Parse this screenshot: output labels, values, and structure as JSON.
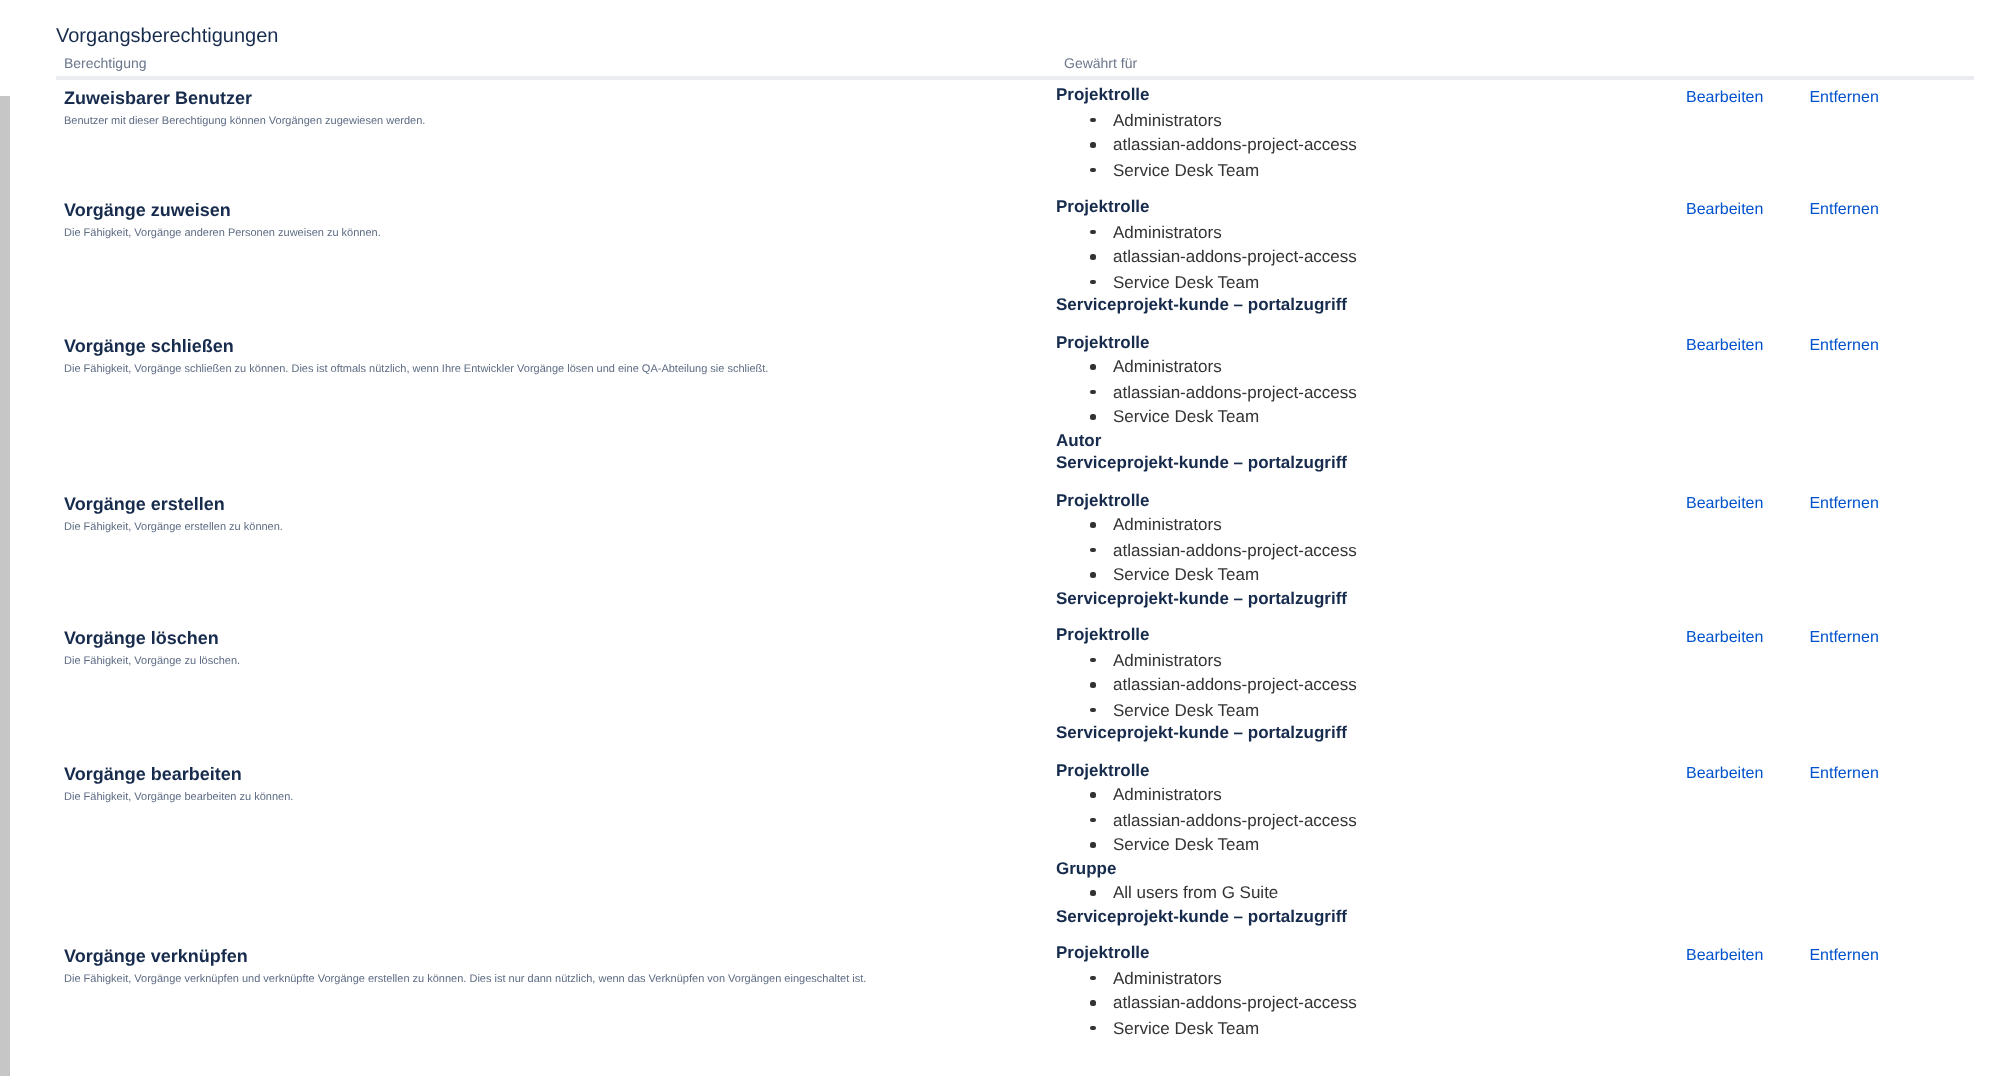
{
  "title": "Vorgangsberechtigungen",
  "columns": [
    "Berechtigung",
    "Gewährt für"
  ],
  "rows": [
    {
      "name": "Zuweisbarer Benutzer",
      "description": "Benutzer mit dieser Berechtigung können Vorgängen zugewiesen werden.",
      "grants": [
        {
          "label": "Projektrolle",
          "members": [
            "Administrators",
            "atlassian-addons-project-access",
            "Service Desk Team"
          ]
        }
      ],
      "actions": [
        "Bearbeiten",
        "Entfernen"
      ]
    },
    {
      "name": "Vorgänge zuweisen",
      "description": "Die Fähigkeit, Vorgänge anderen Personen zuweisen zu können.",
      "grants": [
        {
          "label": "Projektrolle",
          "members": [
            "Administrators",
            "atlassian-addons-project-access",
            "Service Desk Team"
          ]
        },
        {
          "label": "Serviceprojekt-kunde – portalzugriff"
        }
      ],
      "actions": [
        "Bearbeiten",
        "Entfernen"
      ]
    },
    {
      "name": "Vorgänge schließen",
      "description": "Die Fähigkeit, Vorgänge schließen zu können. Dies ist oftmals nützlich, wenn Ihre Entwickler Vorgänge lösen und eine QA-Abteilung sie schließt.",
      "grants": [
        {
          "label": "Projektrolle",
          "members": [
            "Administrators",
            "atlassian-addons-project-access",
            "Service Desk Team"
          ]
        },
        {
          "label": "Autor"
        },
        {
          "label": "Serviceprojekt-kunde – portalzugriff"
        }
      ],
      "actions": [
        "Bearbeiten",
        "Entfernen"
      ]
    },
    {
      "name": "Vorgänge erstellen",
      "description": "Die Fähigkeit, Vorgänge erstellen zu können.",
      "grants": [
        {
          "label": "Projektrolle",
          "members": [
            "Administrators",
            "atlassian-addons-project-access",
            "Service Desk Team"
          ]
        },
        {
          "label": "Serviceprojekt-kunde – portalzugriff"
        }
      ],
      "actions": [
        "Bearbeiten",
        "Entfernen"
      ]
    },
    {
      "name": "Vorgänge löschen",
      "description": "Die Fähigkeit, Vorgänge zu löschen.",
      "grants": [
        {
          "label": "Projektrolle",
          "members": [
            "Administrators",
            "atlassian-addons-project-access",
            "Service Desk Team"
          ]
        },
        {
          "label": "Serviceprojekt-kunde – portalzugriff"
        }
      ],
      "actions": [
        "Bearbeiten",
        "Entfernen"
      ]
    },
    {
      "name": "Vorgänge bearbeiten",
      "description": "Die Fähigkeit, Vorgänge bearbeiten zu können.",
      "grants": [
        {
          "label": "Projektrolle",
          "members": [
            "Administrators",
            "atlassian-addons-project-access",
            "Service Desk Team"
          ]
        },
        {
          "label": "Gruppe",
          "members": [
            "All users from G Suite"
          ]
        },
        {
          "label": "Serviceprojekt-kunde – portalzugriff"
        }
      ],
      "actions": [
        "Bearbeiten",
        "Entfernen"
      ]
    },
    {
      "name": "Vorgänge verknüpfen",
      "description": "Die Fähigkeit, Vorgänge verknüpfen und verknüpfte Vorgänge erstellen zu können. Dies ist nur dann nützlich, wenn das Verknüpfen von Vorgängen eingeschaltet ist.",
      "grants": [
        {
          "label": "Projektrolle",
          "members": [
            "Administrators",
            "atlassian-addons-project-access",
            "Service Desk Team"
          ]
        }
      ],
      "actions": [
        "Bearbeiten",
        "Entfernen"
      ]
    }
  ]
}
